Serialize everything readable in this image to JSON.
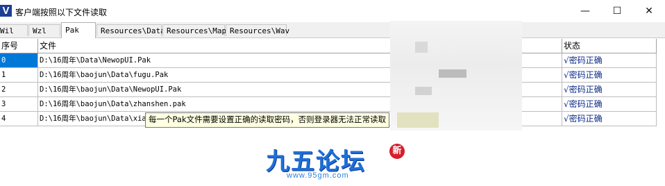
{
  "window": {
    "title": "客户端按照以下文件读取",
    "icon_label": "V",
    "minimize": "—",
    "maximize": "☐",
    "close": "✕"
  },
  "tabs": [
    "Wil",
    "Wzl",
    "Pak",
    "Resources\\Data",
    "Resources\\Map",
    "Resources\\Wav"
  ],
  "active_tab": "Pak",
  "table": {
    "headers": {
      "index": "序号",
      "file": "文件",
      "status": "状态"
    },
    "rows": [
      {
        "index": "0",
        "file": "D:\\16周年\\Data\\NewopUI.Pak",
        "status": "√密码正确"
      },
      {
        "index": "1",
        "file": "D:\\16周年\\baojun\\Data\\fugu.Pak",
        "status": "√密码正确"
      },
      {
        "index": "2",
        "file": "D:\\16周年\\baojun\\Data\\NewopUI.Pak",
        "status": "√密码正确"
      },
      {
        "index": "3",
        "file": "D:\\16周年\\baojun\\Data\\zhanshen.pak",
        "status": "√密码正确"
      },
      {
        "index": "4",
        "file": "D:\\16周年\\baojun\\Data\\xiao",
        "status": "√密码正确"
      }
    ]
  },
  "tooltip": "每一个Pak文件需要设置正确的读取密码，否则登录器无法正常读取",
  "watermark": {
    "name": "九五论坛",
    "badge": "新",
    "url": "www.95gm.com"
  }
}
